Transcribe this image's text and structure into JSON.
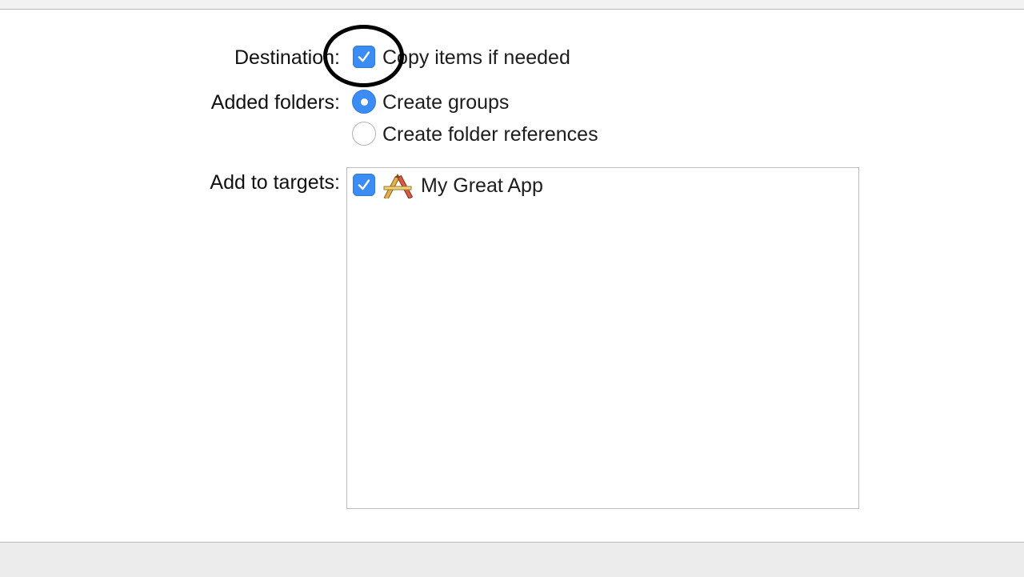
{
  "form": {
    "destination": {
      "label": "Destination:",
      "option_label": "Copy items if needed",
      "checked": true
    },
    "added_folders": {
      "label": "Added folders:",
      "options": [
        {
          "label": "Create groups",
          "selected": true
        },
        {
          "label": "Create folder references",
          "selected": false
        }
      ]
    },
    "targets": {
      "label": "Add to targets:",
      "items": [
        {
          "name": "My Great App",
          "checked": true,
          "icon": "app-icon"
        }
      ]
    }
  },
  "colors": {
    "accent": "#3b8cf5",
    "annotation": "#000000"
  }
}
